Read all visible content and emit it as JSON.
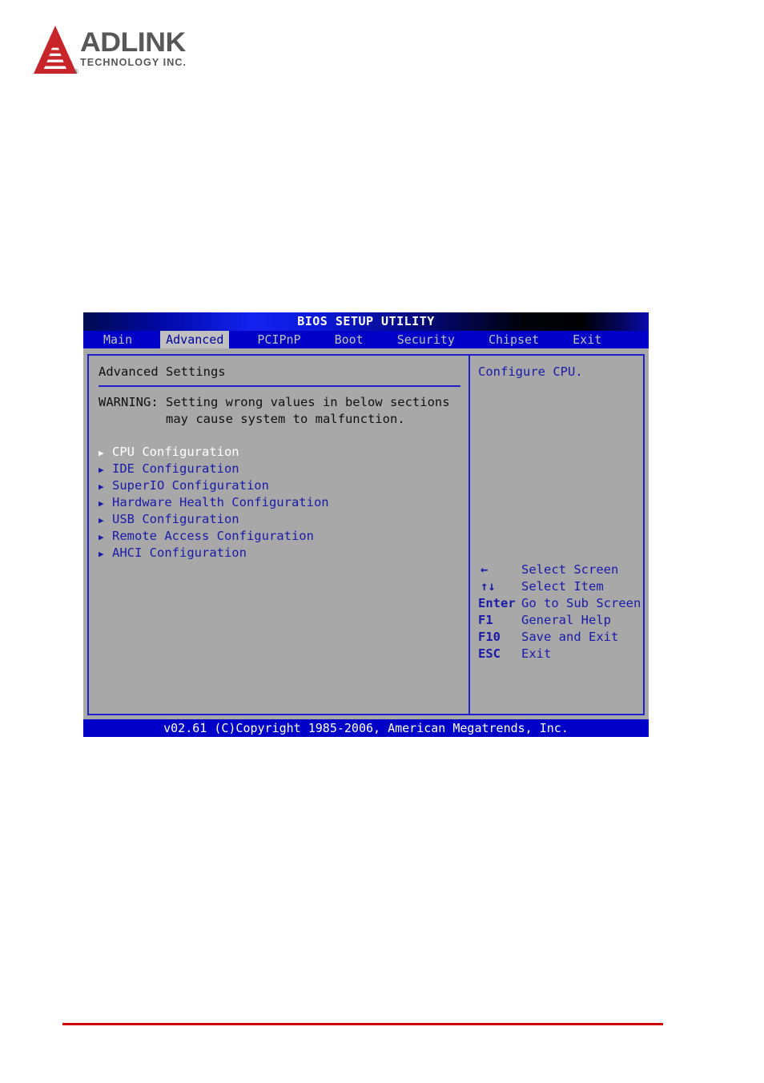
{
  "branding": {
    "company": "ADLINK",
    "tagline": "TECHNOLOGY INC.",
    "registered_mark": "®",
    "logo_color": "#c8252a",
    "wordmark_color": "#58585a"
  },
  "bios": {
    "title": "BIOS SETUP UTILITY",
    "menu_tabs": [
      {
        "label": "Main",
        "active": false
      },
      {
        "label": "Advanced",
        "active": true
      },
      {
        "label": "PCIPnP",
        "active": false
      },
      {
        "label": "Boot",
        "active": false
      },
      {
        "label": "Security",
        "active": false
      },
      {
        "label": "Chipset",
        "active": false
      },
      {
        "label": "Exit",
        "active": false
      }
    ],
    "left_panel": {
      "heading": "Advanced Settings",
      "warning_line1": "WARNING: Setting wrong values in below sections",
      "warning_line2": "         may cause system to malfunction.",
      "items": [
        {
          "label": "CPU Configuration",
          "marker": "▶",
          "selected": true
        },
        {
          "label": "IDE Configuration",
          "marker": "▶",
          "selected": false
        },
        {
          "label": "SuperIO Configuration",
          "marker": "▶",
          "selected": false
        },
        {
          "label": "Hardware Health Configuration",
          "marker": "▶",
          "selected": false
        },
        {
          "label": "USB Configuration",
          "marker": "▶",
          "selected": false
        },
        {
          "label": "Remote Access Configuration",
          "marker": "▶",
          "selected": false
        },
        {
          "label": "AHCI Configuration",
          "marker": "▶",
          "selected": false
        }
      ]
    },
    "right_panel": {
      "help_text": "Configure CPU.",
      "legend": [
        {
          "key": "←",
          "desc": "Select Screen",
          "icon": "left-arrow-icon"
        },
        {
          "key": "↑↓",
          "desc": "Select Item",
          "icon": "up-down-arrow-icon"
        },
        {
          "key": "Enter",
          "desc": "Go to Sub Screen",
          "icon": ""
        },
        {
          "key": "F1",
          "desc": "General Help",
          "icon": ""
        },
        {
          "key": "F10",
          "desc": "Save and Exit",
          "icon": ""
        },
        {
          "key": "ESC",
          "desc": "Exit",
          "icon": ""
        }
      ]
    },
    "footer": "v02.61 (C)Copyright 1985-2006, American Megatrends, Inc.",
    "colors": {
      "panel_bg": "#a8a8a8",
      "accent_blue": "#0000c8",
      "text_blue": "#1a1aa8",
      "selected_text": "#ffffff",
      "rule_red": "#cc0000"
    }
  }
}
